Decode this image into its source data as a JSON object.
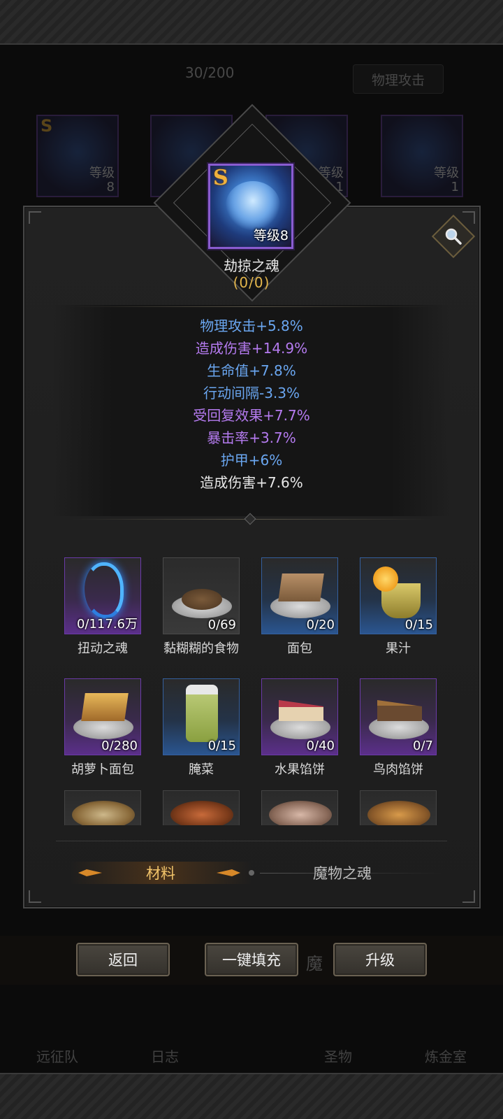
{
  "background": {
    "count_text": "30/200",
    "attr_button": "物理攻击",
    "cards": [
      {
        "rank": "S",
        "level_label": "等级",
        "level": "8"
      },
      {
        "rank": "",
        "level_label": "",
        "level": ""
      },
      {
        "rank": "",
        "level_label": "等级",
        "level": "1"
      },
      {
        "rank": "",
        "level_label": "等级",
        "level": "1"
      }
    ],
    "tab_peek": "魔",
    "nav": [
      "远征队",
      "日志",
      "",
      "圣物",
      "炼金室"
    ]
  },
  "soul": {
    "rank": "S",
    "level_label": "等级8",
    "name": "劫掠之魂",
    "progress": "(0/0)"
  },
  "stats": [
    {
      "text": "物理攻击+5.8%",
      "color": "blue"
    },
    {
      "text": "造成伤害+14.9%",
      "color": "purple"
    },
    {
      "text": "生命值+7.8%",
      "color": "blue"
    },
    {
      "text": "行动间隔-3.3%",
      "color": "blue"
    },
    {
      "text": "受回复效果+7.7%",
      "color": "purple"
    },
    {
      "text": "暴击率+3.7%",
      "color": "purple"
    },
    {
      "text": "护甲+6%",
      "color": "blue"
    },
    {
      "text": "造成伤害+7.6%",
      "color": "white"
    }
  ],
  "materials": [
    {
      "name": "扭动之魂",
      "count": "0/117.6万",
      "rarity": "purple"
    },
    {
      "name": "黏糊糊的食物",
      "count": "0/69",
      "rarity": "gray"
    },
    {
      "name": "面包",
      "count": "0/20",
      "rarity": "blue"
    },
    {
      "name": "果汁",
      "count": "0/15",
      "rarity": "blue"
    },
    {
      "name": "胡萝卜面包",
      "count": "0/280",
      "rarity": "purple"
    },
    {
      "name": "腌菜",
      "count": "0/15",
      "rarity": "blue"
    },
    {
      "name": "水果馅饼",
      "count": "0/40",
      "rarity": "purple"
    },
    {
      "name": "鸟肉馅饼",
      "count": "0/7",
      "rarity": "purple"
    }
  ],
  "tabs": {
    "active": "材料",
    "inactive": "魔物之魂"
  },
  "buttons": {
    "back": "返回",
    "fill": "一键填充",
    "upgrade": "升级"
  },
  "colors": {
    "blue": "#6aa6f0",
    "purple": "#b57bf0",
    "white": "#e8e8e8",
    "gold": "#e3b64c"
  }
}
